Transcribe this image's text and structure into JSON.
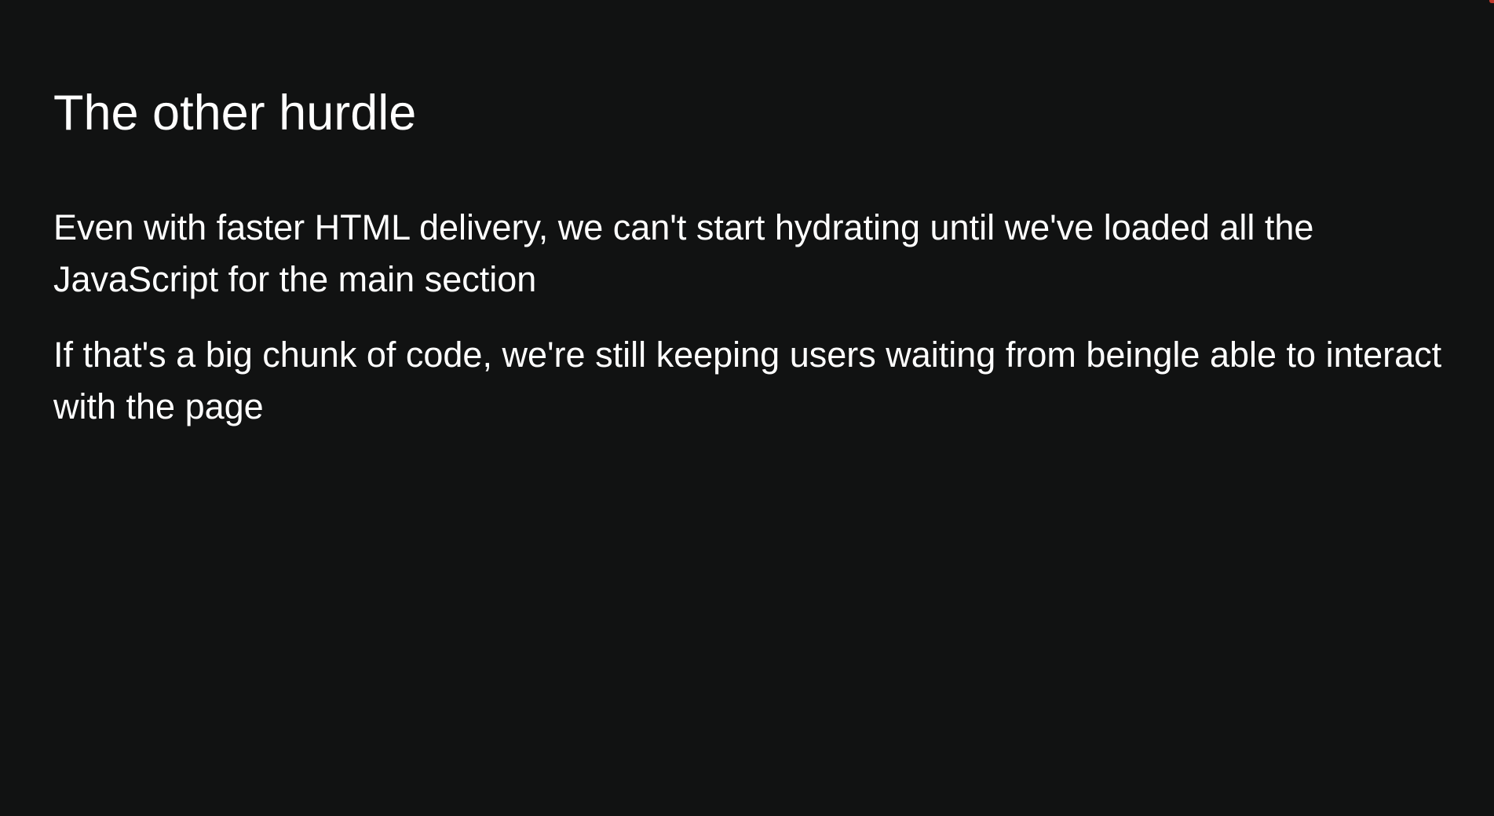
{
  "slide": {
    "title": "The other hurdle",
    "paragraphs": [
      "Even with faster HTML delivery, we can't start hydrating until we've loaded all the JavaScript for the main section",
      "If that's a big chunk of code, we're still keeping users waiting from beingle able to interact with the page"
    ]
  },
  "colors": {
    "background": "#111212",
    "text": "#ffffff"
  }
}
